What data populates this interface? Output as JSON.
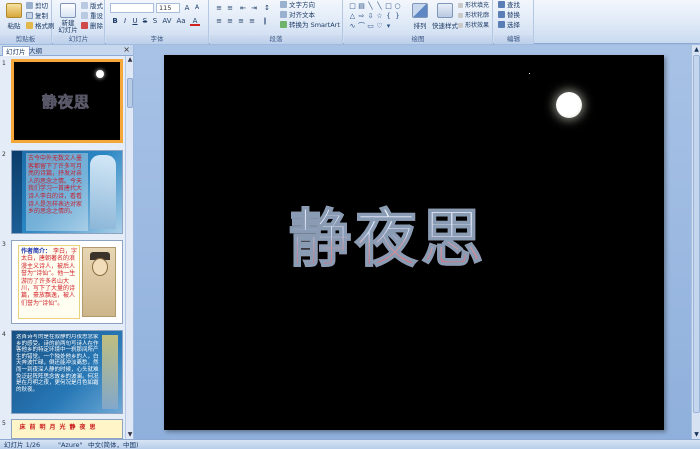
{
  "ribbon": {
    "clipboard": {
      "paste": "粘贴",
      "cut": "剪切",
      "copy": "复制",
      "format_painter": "格式刷",
      "group": "剪贴板"
    },
    "slides": {
      "new_slide": "新建\n幻灯片",
      "layout": "版式",
      "reset": "重设",
      "delete": "删除",
      "group": "幻灯片"
    },
    "font": {
      "font_name": "",
      "font_size": "115",
      "group": "字体"
    },
    "paragraph": {
      "text_direction": "文字方向",
      "align_text": "对齐文本",
      "smartart": "转换为 SmartArt",
      "group": "段落"
    },
    "drawing": {
      "arrange": "排列",
      "quick_styles": "快速样式",
      "shape_fill": "形状填充",
      "shape_outline": "形状轮廓",
      "shape_effects": "形状效果",
      "group": "绘图"
    },
    "editing": {
      "find": "查找",
      "replace": "替换",
      "select": "选择",
      "group": "编辑"
    }
  },
  "pane": {
    "tabs": [
      "幻灯片",
      "大纲"
    ],
    "close": "×",
    "slide_numbers": [
      "1",
      "2",
      "3",
      "4",
      "5"
    ],
    "thumb1_title": "静夜思",
    "thumb2_text": "古今中外无数文人墨客都留下了许多写月亮的诗篇，抒发对亲人的思念之情。今天我们学习一首唐代大诗人李白的诗，看看诗人是怎样表达对家乡的思念之情的。",
    "thumb3_heading": "作者简介：",
    "thumb3_text": "李白，字太白，唐朝著名的浪漫主义诗人，被后人誉为“诗仙”。他一生游历了许多名山大川，写下了大量的诗篇，豪放飘逸，被人们誉为“诗仙”。",
    "thumb4_text": "这首诗写的是在寂静的月夜思念家乡的感受。诗的前两句写诗人在作客他乡的特定环境中一刹那间所产生的错觉。一个独处他乡的人，白天奔波忙碌，倒还能冲淡离愁，然而一到夜深人静的时候，心头就难免泛起阵阵思念故乡的波澜。何况是在月明之夜，更何况是月色如霜的秋夜。",
    "thumb5_cells": [
      "床",
      "前",
      "明",
      "月",
      "光",
      "静",
      "夜",
      "思"
    ]
  },
  "slide": {
    "title": "静夜思"
  },
  "status": {
    "slide_counter": "幻灯片 1/26",
    "theme": "\"Azure\"",
    "language": "中文(简体，中国)"
  }
}
